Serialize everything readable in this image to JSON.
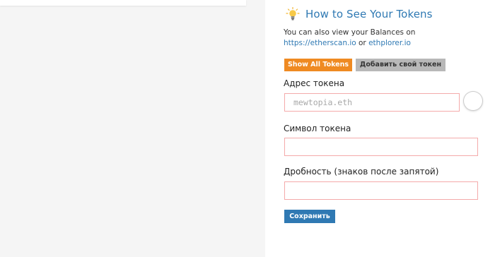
{
  "heading": {
    "title": "How to See Your Tokens"
  },
  "info": {
    "line1": "You can also view your Balances on",
    "link1": "https://etherscan.io",
    "or": " or ",
    "link2": "ethplorer.io"
  },
  "buttons": {
    "show_all": "Show All Tokens",
    "add_token": "Добавить свой токен",
    "save": "Сохранить"
  },
  "form": {
    "address_label": "Адрес токена",
    "address_placeholder": "mewtopia.eth",
    "address_value": "",
    "symbol_label": "Символ токена",
    "symbol_value": "",
    "decimals_label": "Дробность (знаков после запятой)",
    "decimals_value": ""
  },
  "colors": {
    "accent_blue": "#2f79b3",
    "show_all_orange": "#ef8a22",
    "add_token_gray": "#b8b8b8",
    "input_border_error": "#f4aaaa"
  },
  "icons": {
    "heading": "lightbulb-icon",
    "address_status": "identicon-placeholder"
  }
}
